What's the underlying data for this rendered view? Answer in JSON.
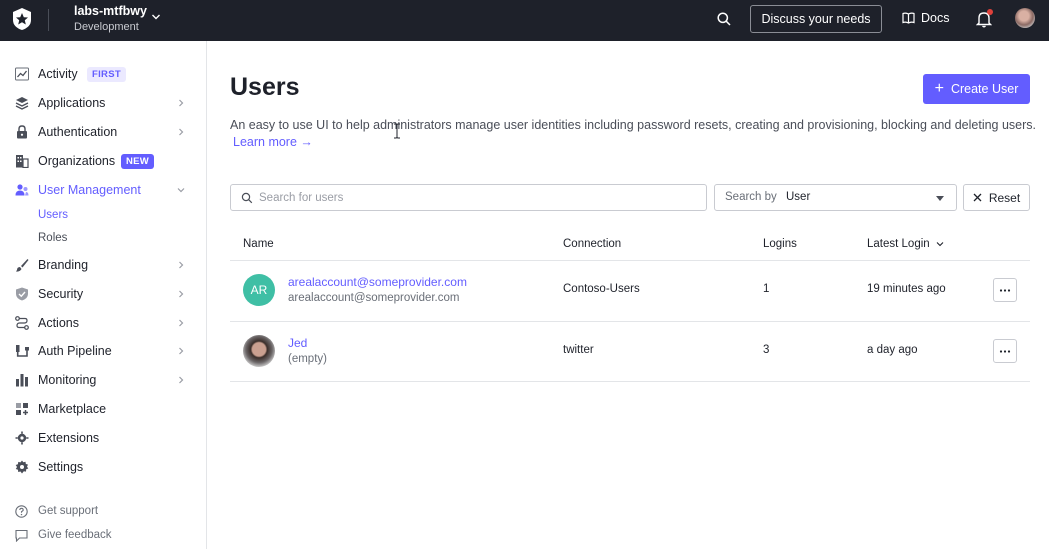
{
  "topbar": {
    "tenant_name": "labs-mtfbwy",
    "tenant_env": "Development",
    "discuss_label": "Discuss your needs",
    "docs_label": "Docs"
  },
  "sidebar": {
    "items": [
      {
        "label": "Activity",
        "badge": "FIRST",
        "icon": "activity-icon"
      },
      {
        "label": "Applications",
        "icon": "layers-icon"
      },
      {
        "label": "Authentication",
        "icon": "lock-icon"
      },
      {
        "label": "Organizations",
        "badge": "NEW",
        "icon": "building-icon"
      },
      {
        "label": "User Management",
        "icon": "users-icon"
      },
      {
        "label": "Branding",
        "icon": "brush-icon"
      },
      {
        "label": "Security",
        "icon": "shield-icon"
      },
      {
        "label": "Actions",
        "icon": "actions-icon"
      },
      {
        "label": "Auth Pipeline",
        "icon": "pipeline-icon"
      },
      {
        "label": "Monitoring",
        "icon": "bar-chart-icon"
      },
      {
        "label": "Marketplace",
        "icon": "grid-plus-icon"
      },
      {
        "label": "Extensions",
        "icon": "puzzle-icon"
      },
      {
        "label": "Settings",
        "icon": "gear-icon"
      }
    ],
    "subitems": [
      "Users",
      "Roles"
    ],
    "footer": [
      "Get support",
      "Give feedback"
    ]
  },
  "main": {
    "title": "Users",
    "create_label": "Create User",
    "description": "An easy to use UI to help administrators manage user identities including password resets, creating and provisioning, blocking and deleting users.",
    "learn_more": "Learn more →",
    "search_placeholder": "Search for users",
    "search_by_label": "Search by",
    "search_by_value": "User",
    "reset_label": "Reset"
  },
  "table": {
    "columns": [
      "Name",
      "Connection",
      "Logins",
      "Latest Login"
    ],
    "rows": [
      {
        "initials": "AR",
        "name": "arealaccount@someprovider.com",
        "sub": "arealaccount@someprovider.com",
        "connection": "Contoso-Users",
        "logins": "1",
        "latest": "19 minutes ago",
        "avatar_color": "#3fbfa5"
      },
      {
        "initials": "",
        "name": "Jed",
        "sub": "(empty)",
        "connection": "twitter",
        "logins": "3",
        "latest": "a day ago"
      }
    ]
  },
  "colors": {
    "accent": "#635dff",
    "topbar": "#1e212a"
  }
}
